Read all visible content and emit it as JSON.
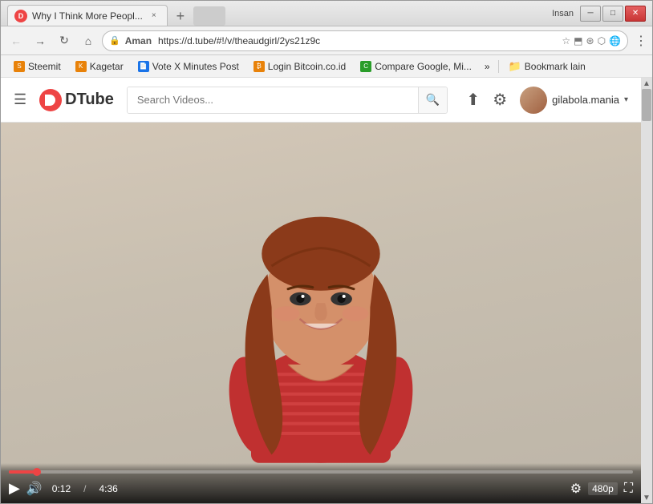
{
  "window": {
    "title": "Why I Think More People",
    "user_label": "Insan"
  },
  "tab": {
    "favicon_text": "D",
    "title": "Why I Think More Peopl...",
    "close_label": "×"
  },
  "titlebar": {
    "minimize": "─",
    "maximize": "□",
    "close": "✕"
  },
  "navbar": {
    "back": "←",
    "forward": "→",
    "refresh": "↻",
    "home": "⌂",
    "lock_icon": "🔒",
    "site": "Aman",
    "url": "https://d.tube/#!/v/theaudgirl/2ys21z9c",
    "star": "☆",
    "more": "⋮"
  },
  "bookmarks": [
    {
      "label": "Steemit",
      "icon_type": "orange"
    },
    {
      "label": "Kagetar",
      "icon_type": "orange"
    },
    {
      "label": "Vote X Minutes Post",
      "icon_type": "blue"
    },
    {
      "label": "Login Bitcoin.co.id",
      "icon_type": "orange"
    },
    {
      "label": "Compare Google, Mi...",
      "icon_type": "green"
    }
  ],
  "bookmarks_more": "»",
  "bookmarks_folder": "Bookmark lain",
  "dtube": {
    "logo_text": "DTube",
    "search_placeholder": "Search Videos...",
    "search_btn": "🔍",
    "upload_icon": "☁",
    "settings_icon": "⚙",
    "username": "gilabola.mania",
    "dropdown": "▾"
  },
  "video": {
    "current_time": "0:12",
    "separator": "/",
    "total_time": "4:36",
    "quality": "480p",
    "progress_pct": 4.5
  },
  "controls": {
    "play": "▶",
    "volume": "🔊",
    "settings": "⚙",
    "fullscreen": "⛶"
  }
}
